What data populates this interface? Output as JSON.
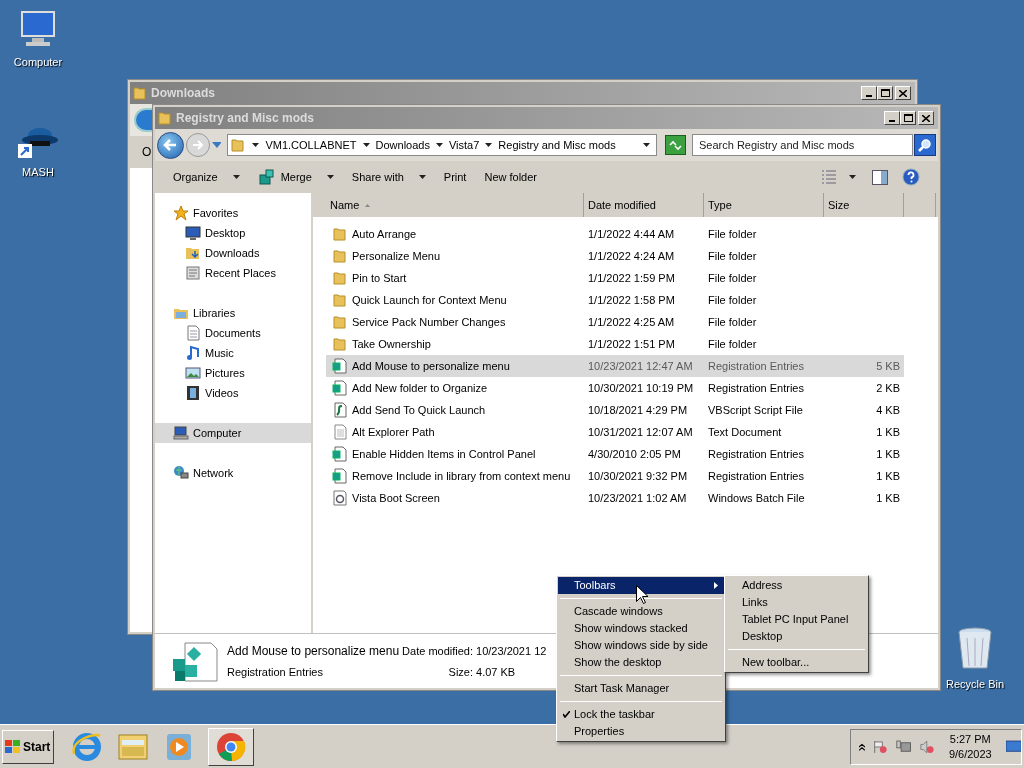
{
  "desktop_icons": [
    {
      "label": "Computer",
      "kind": "computer"
    },
    {
      "label": "MASH",
      "kind": "shortcut"
    },
    {
      "label": "Recycle Bin",
      "kind": "recycle"
    }
  ],
  "back_window": {
    "title": "Downloads",
    "toolbar_text": "O"
  },
  "window": {
    "title": "Registry and Misc mods",
    "address": [
      "VM1.COLLABNET",
      "Downloads",
      "Vista7",
      "Registry and Misc mods"
    ],
    "search": {
      "placeholder": "Search Registry and Misc mods"
    },
    "toolbar": [
      {
        "label": "Organize",
        "icon": false,
        "dropdown": true
      },
      {
        "label": "Merge",
        "icon": true,
        "dropdown": true
      },
      {
        "label": "Share with",
        "icon": false,
        "dropdown": true
      },
      {
        "label": "Print",
        "icon": false,
        "dropdown": false
      },
      {
        "label": "New folder",
        "icon": false,
        "dropdown": false
      }
    ],
    "nav": [
      {
        "label": "Favorites",
        "kind": "star",
        "selected": false,
        "children": [
          {
            "label": "Desktop",
            "kind": "desktop",
            "selected": false
          },
          {
            "label": "Downloads",
            "kind": "downloads",
            "selected": false
          },
          {
            "label": "Recent Places",
            "kind": "recent",
            "selected": false
          }
        ]
      },
      {
        "label": "Libraries",
        "kind": "libraries",
        "selected": false,
        "children": [
          {
            "label": "Documents",
            "kind": "documents",
            "selected": false
          },
          {
            "label": "Music",
            "kind": "music",
            "selected": false
          },
          {
            "label": "Pictures",
            "kind": "pictures",
            "selected": false
          },
          {
            "label": "Videos",
            "kind": "videos",
            "selected": false
          }
        ]
      },
      {
        "label": "Computer",
        "kind": "computer",
        "selected": true
      },
      {
        "label": "Network",
        "kind": "network",
        "selected": false
      }
    ],
    "columns": [
      {
        "label": "Name",
        "sorted": true
      },
      {
        "label": "Date modified",
        "sorted": false
      },
      {
        "label": "Type",
        "sorted": false
      },
      {
        "label": "Size",
        "sorted": false
      }
    ],
    "rows": [
      {
        "name": "Auto Arrange",
        "date": "1/1/2022 4:44 AM",
        "type": "File folder",
        "kind": "folder",
        "selected": false
      },
      {
        "name": "Personalize Menu",
        "date": "1/1/2022 4:24 AM",
        "type": "File folder",
        "kind": "folder",
        "selected": false
      },
      {
        "name": "Pin to Start",
        "date": "1/1/2022 1:59 PM",
        "type": "File folder",
        "kind": "folder",
        "selected": false
      },
      {
        "name": "Quick Launch for Context Menu",
        "date": "1/1/2022 1:58 PM",
        "type": "File folder",
        "kind": "folder",
        "selected": false
      },
      {
        "name": "Service Pack Number Changes",
        "date": "1/1/2022 4:25 AM",
        "type": "File folder",
        "kind": "folder",
        "selected": false
      },
      {
        "name": "Take Ownership",
        "date": "1/1/2022 1:51 PM",
        "type": "File folder",
        "kind": "folder",
        "selected": false
      },
      {
        "name": "Add Mouse to personalize menu",
        "date": "10/23/2021 12:47 AM",
        "type": "Registration Entries",
        "size": "5 KB",
        "kind": "reg",
        "selected": true
      },
      {
        "name": "Add New folder to Organize",
        "date": "10/30/2021 10:19 PM",
        "type": "Registration Entries",
        "size": "2 KB",
        "kind": "reg",
        "selected": false
      },
      {
        "name": "Add Send To Quick Launch",
        "date": "10/18/2021 4:29 PM",
        "type": "VBScript Script File",
        "size": "4 KB",
        "kind": "script",
        "selected": false
      },
      {
        "name": "Alt Explorer Path",
        "date": "10/31/2021 12:07 AM",
        "type": "Text Document",
        "size": "1 KB",
        "kind": "text",
        "selected": false
      },
      {
        "name": "Enable Hidden Items in Control Panel",
        "date": "4/30/2010 2:05 PM",
        "type": "Registration Entries",
        "size": "1 KB",
        "kind": "reg",
        "selected": false
      },
      {
        "name": "Remove Include in library from context menu",
        "date": "10/30/2021 9:32 PM",
        "type": "Registration Entries",
        "size": "1 KB",
        "kind": "reg",
        "selected": false
      },
      {
        "name": "Vista Boot Screen",
        "date": "10/23/2021 1:02 AM",
        "type": "Windows Batch File",
        "size": "1 KB",
        "kind": "batch",
        "selected": false
      }
    ],
    "details": {
      "name": "Add Mouse to personalize menu",
      "type": "Registration Entries",
      "date_label": "Date modified:",
      "date": "10/23/2021 12",
      "size_label": "Size:",
      "size": "4.07 KB"
    }
  },
  "context_menu": [
    {
      "kind": "item",
      "label": "Toolbars",
      "selected": true,
      "checked": false,
      "submenu": true
    },
    {
      "kind": "separator"
    },
    {
      "kind": "item",
      "label": "Cascade windows",
      "selected": false,
      "checked": false,
      "submenu": false
    },
    {
      "kind": "item",
      "label": "Show windows stacked",
      "selected": false,
      "checked": false,
      "submenu": false
    },
    {
      "kind": "item",
      "label": "Show windows side by side",
      "selected": false,
      "checked": false,
      "submenu": false
    },
    {
      "kind": "item",
      "label": "Show the desktop",
      "selected": false,
      "checked": false,
      "submenu": false
    },
    {
      "kind": "separator"
    },
    {
      "kind": "item",
      "label": "Start Task Manager",
      "selected": false,
      "checked": false,
      "submenu": false
    },
    {
      "kind": "separator"
    },
    {
      "kind": "item",
      "label": "Lock the taskbar",
      "selected": false,
      "checked": true,
      "submenu": false
    },
    {
      "kind": "item",
      "label": "Properties",
      "selected": false,
      "checked": false,
      "submenu": false
    }
  ],
  "submenu": [
    {
      "kind": "item",
      "label": "Address"
    },
    {
      "kind": "item",
      "label": "Links"
    },
    {
      "kind": "item",
      "label": "Tablet PC Input Panel"
    },
    {
      "kind": "item",
      "label": "Desktop"
    },
    {
      "kind": "separator"
    },
    {
      "kind": "item",
      "label": "New toolbar..."
    }
  ],
  "taskbar": {
    "start": "Start",
    "apps": [
      {
        "kind": "browser-e",
        "open": false
      },
      {
        "kind": "explorer",
        "open": false
      },
      {
        "kind": "media",
        "open": false
      },
      {
        "kind": "chrome",
        "open": true
      }
    ],
    "time": "5:27 PM",
    "date": "9/6/2023"
  }
}
